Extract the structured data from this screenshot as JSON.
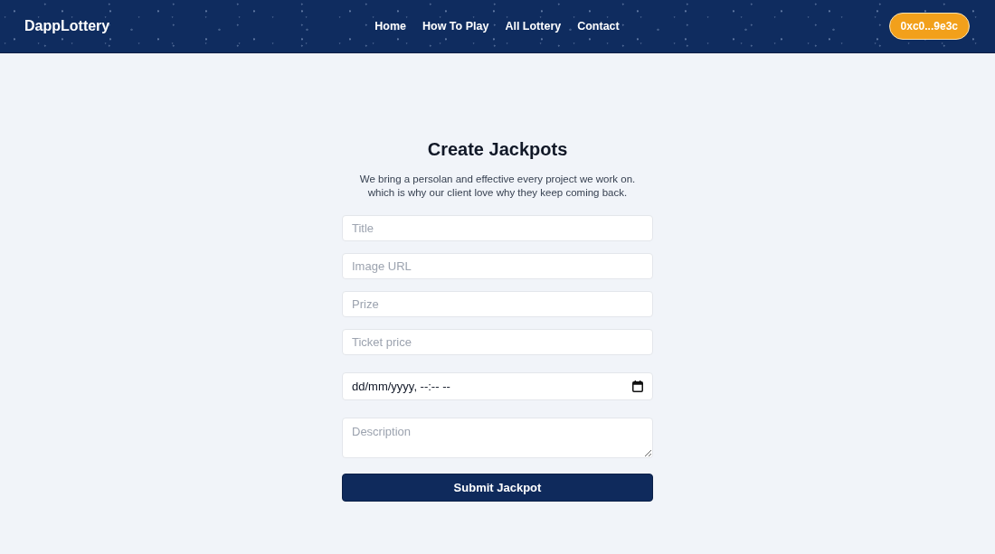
{
  "header": {
    "logo": "DappLottery",
    "nav": [
      {
        "label": "Home"
      },
      {
        "label": "How To Play"
      },
      {
        "label": "All Lottery"
      },
      {
        "label": "Contact"
      }
    ],
    "wallet_button": "0xc0...9e3c"
  },
  "form": {
    "title": "Create Jackpots",
    "description": "We bring a persolan and effective every project we work on.\nwhich is why our client love why they keep coming back.",
    "fields": [
      {
        "kind": "text",
        "placeholder": "Title"
      },
      {
        "kind": "text",
        "placeholder": "Image URL"
      },
      {
        "kind": "text",
        "placeholder": "Prize"
      },
      {
        "kind": "text",
        "placeholder": "Ticket price"
      },
      {
        "kind": "datetime",
        "placeholder": "dd/mm/yyyy, --:-- --"
      },
      {
        "kind": "textarea",
        "placeholder": "Description"
      }
    ],
    "submit_button": "Submit Jackpot"
  }
}
